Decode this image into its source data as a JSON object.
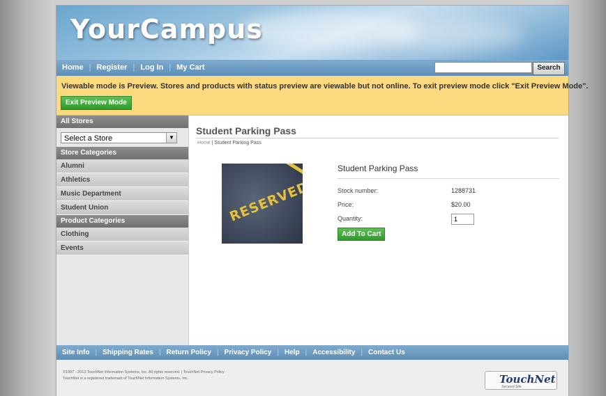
{
  "header": {
    "logo_text": "YourCampus"
  },
  "nav": {
    "links": [
      "Home",
      "Register",
      "Log In",
      "My Cart"
    ],
    "search_value": "",
    "search_button": "Search"
  },
  "preview": {
    "message": "Viewable mode is Preview. Stores and products with status preview are viewable but not online. To exit preview mode click \"Exit Preview Mode\".",
    "exit_button": "Exit Preview Mode"
  },
  "sidebar": {
    "all_stores_header": "All Stores",
    "store_select_value": "Select a Store",
    "store_categories_header": "Store Categories",
    "store_categories": [
      "Alumni",
      "Athletics",
      "Music Department",
      "Student Union"
    ],
    "product_categories_header": "Product Categories",
    "product_categories": [
      "Clothing",
      "Events"
    ]
  },
  "product": {
    "title": "Student Parking Pass",
    "breadcrumb_home": "Home",
    "breadcrumb_sep": " | ",
    "breadcrumb_current": "Student Parking Pass",
    "image_text": "RESERVED",
    "detail_title": "Student Parking Pass",
    "stock_label": "Stock number:",
    "stock_value": "1288731",
    "price_label": "Price:",
    "price_value": "$20.00",
    "quantity_label": "Quantity:",
    "quantity_value": "1",
    "add_button": "Add To Cart"
  },
  "footer_nav": {
    "links": [
      "Site Info",
      "Shipping Rates",
      "Return Policy",
      "Privacy Policy",
      "Help",
      "Accessibility",
      "Contact Us"
    ]
  },
  "footer": {
    "copyright_line1": "©1997 - 2013 TouchNet Information Systems, Inc. All rights reserved. | TouchNet Privacy Policy",
    "copyright_line2": "TouchNet is a registered trademark of TouchNet Information Systems, Inc.",
    "logo_text": "TouchNet",
    "logo_subtext": "Secured Site"
  },
  "colors": {
    "nav_bar": "#6a9bc3",
    "preview_bg": "#fad97f",
    "button_green": "#3fa83a"
  }
}
